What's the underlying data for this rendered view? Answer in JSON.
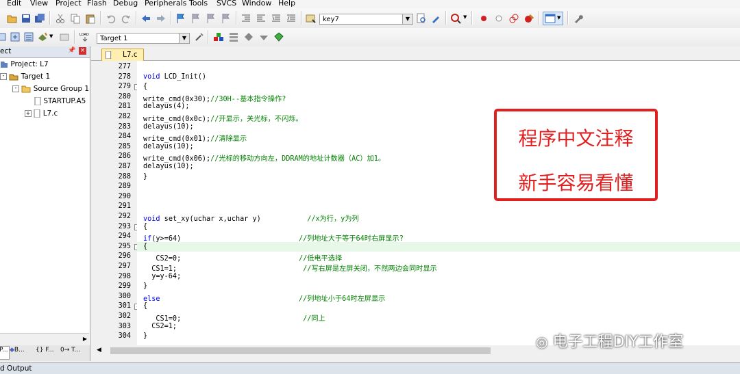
{
  "menu": [
    "Edit",
    "View",
    "Project",
    "Flash",
    "Debug",
    "Peripherals",
    "Tools",
    "SVCS",
    "Window",
    "Help"
  ],
  "toolbar": {
    "find_combo": "key7",
    "target_combo": "Target 1"
  },
  "project_panel": {
    "title": "ect",
    "tree": [
      {
        "label": "Project: L7"
      },
      {
        "label": "Target 1"
      },
      {
        "label": "Source Group 1"
      },
      {
        "label": "STARTUP.A5"
      },
      {
        "label": "L7.c"
      }
    ],
    "bottom_tabs": [
      "P...",
      "B...",
      "{} F...",
      "0→ T..."
    ]
  },
  "editor": {
    "tab": "L7.c",
    "lines": [
      {
        "n": "277",
        "code": "",
        "comment": ""
      },
      {
        "n": "278",
        "code": "void LCD_Init()",
        "comment": ""
      },
      {
        "n": "279",
        "code": "{",
        "comment": "",
        "fold": "-"
      },
      {
        "n": "280",
        "code": "write_cmd(0x30);",
        "comment": "//30H--基本指令操作?"
      },
      {
        "n": "281",
        "code": "delayus(4);",
        "comment": ""
      },
      {
        "n": "282",
        "code": "write_cmd(0x0c);",
        "comment": "//开显示，关光标，不闪烁。"
      },
      {
        "n": "283",
        "code": "delayus(10);",
        "comment": ""
      },
      {
        "n": "284",
        "code": "write_cmd(0x01);",
        "comment": "//清除显示"
      },
      {
        "n": "285",
        "code": "delayus(10);",
        "comment": ""
      },
      {
        "n": "286",
        "code": "write_cmd(0x06);",
        "comment": "//光标的移动方向左，DDRAM的地址计数器（AC）加1。"
      },
      {
        "n": "287",
        "code": "delayus(10);",
        "comment": ""
      },
      {
        "n": "288",
        "code": "}",
        "comment": ""
      },
      {
        "n": "289",
        "code": "",
        "comment": ""
      },
      {
        "n": "290",
        "code": "",
        "comment": ""
      },
      {
        "n": "291",
        "code": "",
        "comment": ""
      },
      {
        "n": "292",
        "code": "void set_xy(uchar x,uchar y)           ",
        "comment": "//x为行，y为列"
      },
      {
        "n": "293",
        "code": "{",
        "comment": "",
        "fold": "-"
      },
      {
        "n": "294",
        "code": "if(y>=64)                            ",
        "comment": "//列地址大于等于64时右屏显示?"
      },
      {
        "n": "295",
        "code": "{",
        "comment": "",
        "fold": "-",
        "hl": true
      },
      {
        "n": "296",
        "code": "   CS2=0;                            ",
        "comment": "//低电平选择"
      },
      {
        "n": "297",
        "code": "  CS1=1;                              ",
        "comment": "//写右屏是左屏关闭，不然两边会同时显示"
      },
      {
        "n": "298",
        "code": "  y=y-64;",
        "comment": ""
      },
      {
        "n": "299",
        "code": "}",
        "comment": ""
      },
      {
        "n": "300",
        "code": "else                                 ",
        "comment": "//列地址小于64时左屏显示"
      },
      {
        "n": "301",
        "code": "{",
        "comment": "",
        "fold": "-"
      },
      {
        "n": "302",
        "code": "   CS1=0;                             ",
        "comment": "//同上"
      },
      {
        "n": "303",
        "code": "  CS2=1;",
        "comment": ""
      },
      {
        "n": "304",
        "code": "}",
        "comment": ""
      }
    ]
  },
  "annotation": {
    "line1": "程序中文注释",
    "line2": "新手容易看懂"
  },
  "watermark": "电子工程DIY工作室",
  "build_output": "d Output",
  "colors": {
    "comment": "#008000",
    "keyword": "#0000ff",
    "annotation": "#e02020",
    "current_line": "#e8f8e8"
  }
}
